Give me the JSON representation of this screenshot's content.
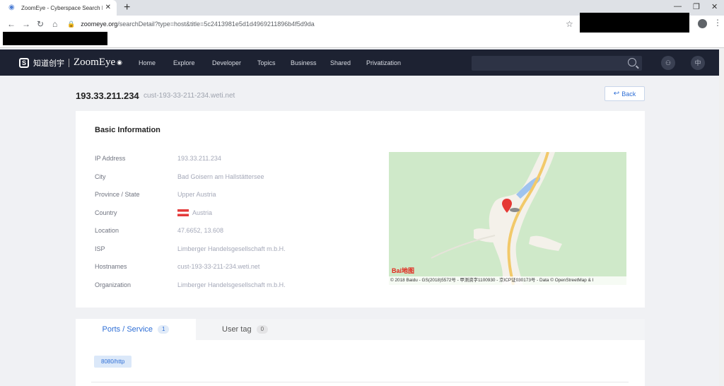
{
  "browser": {
    "tab_title": "ZoomEye - Cyberspace Search En",
    "url_host": "zoomeye.org",
    "url_path": "/searchDetail?type=host&title=5c2413981e5d1d4969211896b4f5d9da"
  },
  "nav": {
    "logo_cn": "知道创宇",
    "logo_en": "ZoomEye",
    "links": [
      "Home",
      "Explore",
      "Developer",
      "Topics",
      "Business",
      "Shared",
      "Privatization"
    ],
    "lang": "中"
  },
  "header": {
    "ip": "193.33.211.234",
    "hostname": "cust-193-33-211-234.weti.net",
    "back_label": "Back"
  },
  "basic_info": {
    "title": "Basic Information",
    "rows": [
      {
        "label": "IP Address",
        "value": "193.33.211.234"
      },
      {
        "label": "City",
        "value": "Bad Goisern am Hallstättersee"
      },
      {
        "label": "Province / State",
        "value": "Upper Austria"
      },
      {
        "label": "Country",
        "value": "Austria"
      },
      {
        "label": "Location",
        "value": "47.6652, 13.608"
      },
      {
        "label": "ISP",
        "value": "Limberger Handelsgesellschaft m.b.H."
      },
      {
        "label": "Hostnames",
        "value": "cust-193-33-211-234.weti.net"
      },
      {
        "label": "Organization",
        "value": "Limberger Handelsgesellschaft m.b.H."
      }
    ],
    "map_attribution": "© 2018 Baidu - GS(2018)5572号 - 甲测资字1100930 - 京ICP证030173号 - Data © OpenStreetMap & I",
    "map_logo": "Bai地图"
  },
  "tabs": [
    {
      "label": "Ports / Service",
      "count": "1"
    },
    {
      "label": "User tag",
      "count": "0"
    }
  ],
  "ports": [
    "8080/http"
  ],
  "colors": {
    "accent": "#2f6fd6",
    "nav_bg": "#1d2232"
  }
}
